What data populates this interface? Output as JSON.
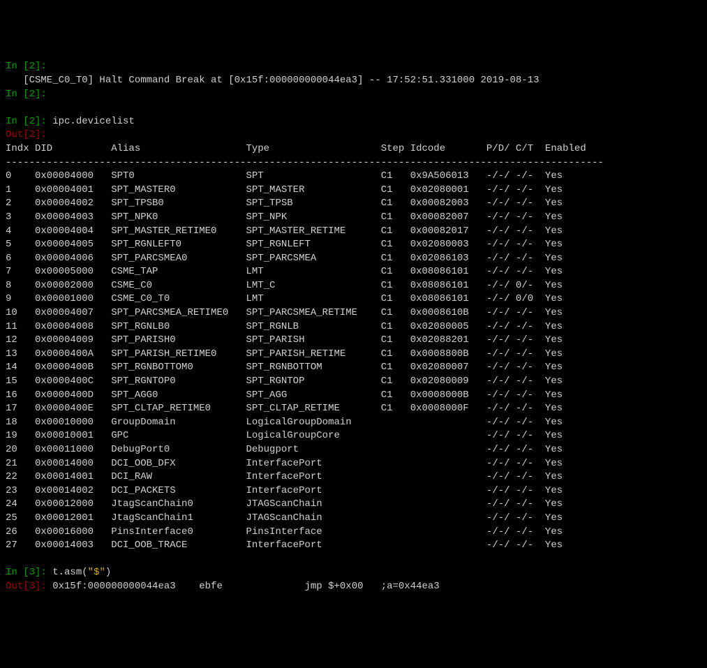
{
  "lines": {
    "l1a": "In [2]:",
    "l1b": "   [CSME_C0_T0] Halt Command Break at [0x15f:000000000044ea3] -- 17:52:51.331000 2019-08-13",
    "l1c": "In [2]:",
    "blank1": "",
    "in2": "In [2]: ",
    "cmd2": "ipc.devicelist",
    "out2": "Out[2]:",
    "header": "Indx DID          Alias                  Type                   Step Idcode       P/D/ C/T  Enabled",
    "sep": "------------------------------------------------------------------------------------------------------",
    "blank2": "",
    "in3": "In [3]: ",
    "cmd3a": "t.asm(",
    "cmd3b": "\"$\"",
    "cmd3c": ")",
    "out3": "Out[3]: ",
    "out3v": "0x15f:000000000044ea3    ebfe              jmp $+0x00   ;a=0x44ea3"
  },
  "chart_data": {
    "type": "table",
    "columns": [
      "Indx",
      "DID",
      "Alias",
      "Type",
      "Step",
      "Idcode",
      "P/D/ C/T",
      "Enabled"
    ],
    "rows": [
      {
        "Indx": "0",
        "DID": "0x00004000",
        "Alias": "SPT0",
        "Type": "SPT",
        "Step": "C1",
        "Idcode": "0x9A506013",
        "PDCT": "-/-/ -/-",
        "Enabled": "Yes"
      },
      {
        "Indx": "1",
        "DID": "0x00004001",
        "Alias": "SPT_MASTER0",
        "Type": "SPT_MASTER",
        "Step": "C1",
        "Idcode": "0x02080001",
        "PDCT": "-/-/ -/-",
        "Enabled": "Yes"
      },
      {
        "Indx": "2",
        "DID": "0x00004002",
        "Alias": "SPT_TPSB0",
        "Type": "SPT_TPSB",
        "Step": "C1",
        "Idcode": "0x00082003",
        "PDCT": "-/-/ -/-",
        "Enabled": "Yes"
      },
      {
        "Indx": "3",
        "DID": "0x00004003",
        "Alias": "SPT_NPK0",
        "Type": "SPT_NPK",
        "Step": "C1",
        "Idcode": "0x00082007",
        "PDCT": "-/-/ -/-",
        "Enabled": "Yes"
      },
      {
        "Indx": "4",
        "DID": "0x00004004",
        "Alias": "SPT_MASTER_RETIME0",
        "Type": "SPT_MASTER_RETIME",
        "Step": "C1",
        "Idcode": "0x00082017",
        "PDCT": "-/-/ -/-",
        "Enabled": "Yes"
      },
      {
        "Indx": "5",
        "DID": "0x00004005",
        "Alias": "SPT_RGNLEFT0",
        "Type": "SPT_RGNLEFT",
        "Step": "C1",
        "Idcode": "0x02080003",
        "PDCT": "-/-/ -/-",
        "Enabled": "Yes"
      },
      {
        "Indx": "6",
        "DID": "0x00004006",
        "Alias": "SPT_PARCSMEA0",
        "Type": "SPT_PARCSMEA",
        "Step": "C1",
        "Idcode": "0x02086103",
        "PDCT": "-/-/ -/-",
        "Enabled": "Yes"
      },
      {
        "Indx": "7",
        "DID": "0x00005000",
        "Alias": "CSME_TAP",
        "Type": "LMT",
        "Step": "C1",
        "Idcode": "0x08086101",
        "PDCT": "-/-/ -/-",
        "Enabled": "Yes"
      },
      {
        "Indx": "8",
        "DID": "0x00002000",
        "Alias": "CSME_C0",
        "Type": "LMT_C",
        "Step": "C1",
        "Idcode": "0x08086101",
        "PDCT": "-/-/ 0/-",
        "Enabled": "Yes"
      },
      {
        "Indx": "9",
        "DID": "0x00001000",
        "Alias": "CSME_C0_T0",
        "Type": "LMT",
        "Step": "C1",
        "Idcode": "0x08086101",
        "PDCT": "-/-/ 0/0",
        "Enabled": "Yes"
      },
      {
        "Indx": "10",
        "DID": "0x00004007",
        "Alias": "SPT_PARCSMEA_RETIME0",
        "Type": "SPT_PARCSMEA_RETIME",
        "Step": "C1",
        "Idcode": "0x0008610B",
        "PDCT": "-/-/ -/-",
        "Enabled": "Yes"
      },
      {
        "Indx": "11",
        "DID": "0x00004008",
        "Alias": "SPT_RGNLB0",
        "Type": "SPT_RGNLB",
        "Step": "C1",
        "Idcode": "0x02080005",
        "PDCT": "-/-/ -/-",
        "Enabled": "Yes"
      },
      {
        "Indx": "12",
        "DID": "0x00004009",
        "Alias": "SPT_PARISH0",
        "Type": "SPT_PARISH",
        "Step": "C1",
        "Idcode": "0x02088201",
        "PDCT": "-/-/ -/-",
        "Enabled": "Yes"
      },
      {
        "Indx": "13",
        "DID": "0x0000400A",
        "Alias": "SPT_PARISH_RETIME0",
        "Type": "SPT_PARISH_RETIME",
        "Step": "C1",
        "Idcode": "0x0008800B",
        "PDCT": "-/-/ -/-",
        "Enabled": "Yes"
      },
      {
        "Indx": "14",
        "DID": "0x0000400B",
        "Alias": "SPT_RGNBOTTOM0",
        "Type": "SPT_RGNBOTTOM",
        "Step": "C1",
        "Idcode": "0x02080007",
        "PDCT": "-/-/ -/-",
        "Enabled": "Yes"
      },
      {
        "Indx": "15",
        "DID": "0x0000400C",
        "Alias": "SPT_RGNTOP0",
        "Type": "SPT_RGNTOP",
        "Step": "C1",
        "Idcode": "0x02080009",
        "PDCT": "-/-/ -/-",
        "Enabled": "Yes"
      },
      {
        "Indx": "16",
        "DID": "0x0000400D",
        "Alias": "SPT_AGG0",
        "Type": "SPT_AGG",
        "Step": "C1",
        "Idcode": "0x0008000B",
        "PDCT": "-/-/ -/-",
        "Enabled": "Yes"
      },
      {
        "Indx": "17",
        "DID": "0x0000400E",
        "Alias": "SPT_CLTAP_RETIME0",
        "Type": "SPT_CLTAP_RETIME",
        "Step": "C1",
        "Idcode": "0x0008000F",
        "PDCT": "-/-/ -/-",
        "Enabled": "Yes"
      },
      {
        "Indx": "18",
        "DID": "0x00010000",
        "Alias": "GroupDomain",
        "Type": "LogicalGroupDomain",
        "Step": "",
        "Idcode": "",
        "PDCT": "-/-/ -/-",
        "Enabled": "Yes"
      },
      {
        "Indx": "19",
        "DID": "0x00010001",
        "Alias": "GPC",
        "Type": "LogicalGroupCore",
        "Step": "",
        "Idcode": "",
        "PDCT": "-/-/ -/-",
        "Enabled": "Yes"
      },
      {
        "Indx": "20",
        "DID": "0x00011000",
        "Alias": "DebugPort0",
        "Type": "Debugport",
        "Step": "",
        "Idcode": "",
        "PDCT": "-/-/ -/-",
        "Enabled": "Yes"
      },
      {
        "Indx": "21",
        "DID": "0x00014000",
        "Alias": "DCI_OOB_DFX",
        "Type": "InterfacePort",
        "Step": "",
        "Idcode": "",
        "PDCT": "-/-/ -/-",
        "Enabled": "Yes"
      },
      {
        "Indx": "22",
        "DID": "0x00014001",
        "Alias": "DCI_RAW",
        "Type": "InterfacePort",
        "Step": "",
        "Idcode": "",
        "PDCT": "-/-/ -/-",
        "Enabled": "Yes"
      },
      {
        "Indx": "23",
        "DID": "0x00014002",
        "Alias": "DCI_PACKETS",
        "Type": "InterfacePort",
        "Step": "",
        "Idcode": "",
        "PDCT": "-/-/ -/-",
        "Enabled": "Yes"
      },
      {
        "Indx": "24",
        "DID": "0x00012000",
        "Alias": "JtagScanChain0",
        "Type": "JTAGScanChain",
        "Step": "",
        "Idcode": "",
        "PDCT": "-/-/ -/-",
        "Enabled": "Yes"
      },
      {
        "Indx": "25",
        "DID": "0x00012001",
        "Alias": "JtagScanChain1",
        "Type": "JTAGScanChain",
        "Step": "",
        "Idcode": "",
        "PDCT": "-/-/ -/-",
        "Enabled": "Yes"
      },
      {
        "Indx": "26",
        "DID": "0x00016000",
        "Alias": "PinsInterface0",
        "Type": "PinsInterface",
        "Step": "",
        "Idcode": "",
        "PDCT": "-/-/ -/-",
        "Enabled": "Yes"
      },
      {
        "Indx": "27",
        "DID": "0x00014003",
        "Alias": "DCI_OOB_TRACE",
        "Type": "InterfacePort",
        "Step": "",
        "Idcode": "",
        "PDCT": "-/-/ -/-",
        "Enabled": "Yes"
      }
    ]
  }
}
